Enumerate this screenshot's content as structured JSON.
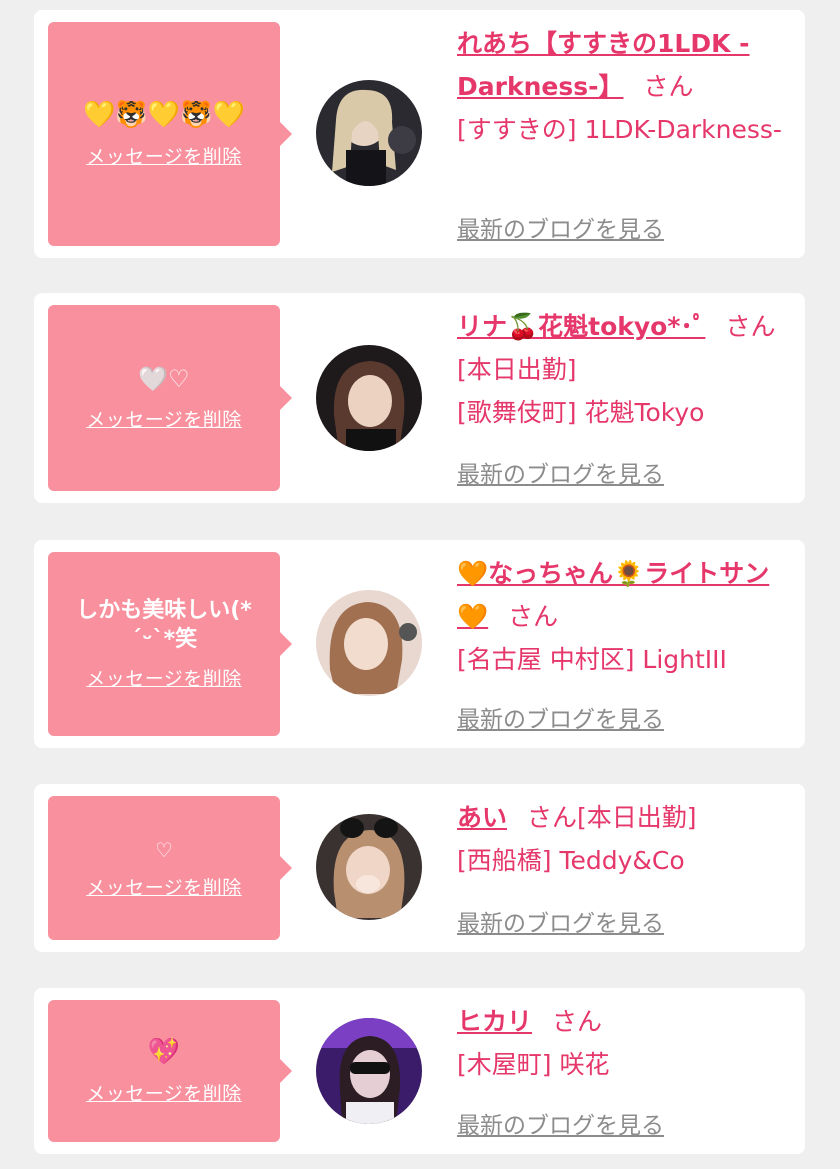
{
  "delete_label": "メッセージを削除",
  "blog_label": "最新のブログを見る",
  "san_suffix": "さん",
  "colors": {
    "page_background": "#efefef",
    "card": "#ffffff",
    "bubble": "#f9909e",
    "name_pink": "#e6376b",
    "blog_gray": "#8c8c8c"
  },
  "messages": [
    {
      "message": "💛🐯💛🐯💛",
      "name": "れあち【すすきの1LDK -Darkness-】",
      "badge": "",
      "location": "[すすきの] 1LDK-Darkness-",
      "avatar_icon": "girl-photo-avatar"
    },
    {
      "message": "🤍♡",
      "name": "リナ🍒花魁tokyo*･ﾟ",
      "badge": "[本日出勤]",
      "location": "[歌舞伎町] 花魁Tokyo",
      "avatar_icon": "girl-photo-avatar"
    },
    {
      "message": "しかも美味しい(*´ᵕ`*笑",
      "name": "🧡なっちゃん🌻ライトサン🧡",
      "badge": "",
      "location": "[名古屋 中村区] LightIII",
      "avatar_icon": "girl-photo-avatar"
    },
    {
      "message": "♡",
      "name": "あい",
      "badge": "[本日出勤]",
      "location": "[西船橋] Teddy&Co",
      "avatar_icon": "girl-photo-avatar"
    },
    {
      "message": "💖",
      "name": "ヒカリ",
      "badge": "",
      "location": "[木屋町] 咲花",
      "avatar_icon": "girl-photo-avatar"
    }
  ]
}
